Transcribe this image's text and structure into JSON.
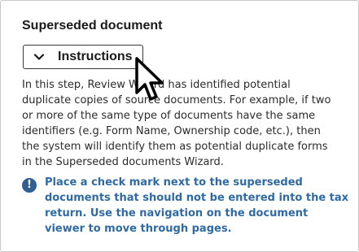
{
  "section": {
    "title": "Superseded document"
  },
  "instructions_button": {
    "label": "Instructions",
    "icon": "chevron-down-icon"
  },
  "body": {
    "lines": [
      "In this step, Review Wizard has identified potential",
      "duplicate copies of source documents. For example, if two",
      "or more of the same type of documents have the same",
      "identifiers (e.g. Form Name, Ownership code, etc.), then",
      "the system will identify them as potential duplicate forms",
      "in the Superseded documents Wizard."
    ]
  },
  "info": {
    "icon_glyph": "!",
    "icon": "info-exclamation-icon",
    "lines": [
      "Place a check mark next to the superseded",
      "documents that should not be entered into the tax",
      "return. Use the navigation on the document",
      "viewer to move through pages."
    ],
    "color": "#2f6aa3"
  },
  "cursor": {
    "icon": "mouse-pointer-icon"
  }
}
